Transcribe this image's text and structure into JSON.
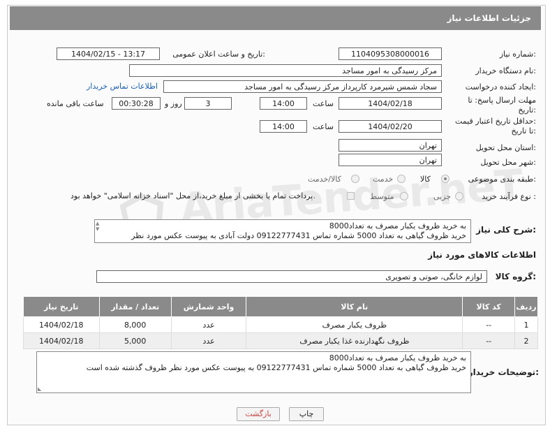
{
  "header": {
    "title": "جزئیات اطلاعات نیاز"
  },
  "fields": {
    "need_number_label": "شماره نیاز:",
    "need_number": "1104095308000016",
    "announce_label": "تاریخ و ساعت اعلان عمومی:",
    "announce_value": "1404/02/15 - 13:17",
    "buyer_org_label": "نام دستگاه خریدار:",
    "buyer_org": "مرکز رسیدگی به امور مساجد",
    "requester_label": "ایجاد کننده درخواست:",
    "requester": "سجاد شمس شیرمرد کارپرداز مرکز رسیدگی به امور مساجد",
    "buyer_contact_link": "اطلاعات تماس خریدار",
    "deadline_label_1": "مهلت ارسال پاسخ: تا",
    "deadline_label_2": "تاریخ:",
    "deadline_date": "1404/02/18",
    "time_label": "ساعت",
    "deadline_time": "14:00",
    "days_value": "3",
    "days_label": "روز و",
    "remaining_value": "00:30:28",
    "remaining_label": "ساعت باقی مانده",
    "validity_label_1": "حداقل تاریخ اعتبار قیمت:",
    "validity_label_2": "تا تاریخ:",
    "validity_date": "1404/02/20",
    "validity_time": "14:00",
    "province_label": "استان محل تحویل:",
    "province": "تهران",
    "city_label": "شهر محل تحویل:",
    "city": "تهران",
    "category_label": "طبقه بندی موضوعی:",
    "category_options": [
      "کالا",
      "خدمت",
      "کالا/خدمت"
    ],
    "process_label": "نوع فرآیند خرید :",
    "process_options": [
      "جزیی",
      "متوسط"
    ],
    "payment_note": "پرداخت تمام یا بخشی از مبلغ خرید،از محل \"اسناد خزانه اسلامی\" خواهد بود."
  },
  "summary": {
    "label": "شرح کلی نیاز:",
    "line1": "به خرید ظروف یکبار مصرف به تعداد8000",
    "line2": "خرید ظروف گیاهی به تعداد 5000   شماره تماس 09122777431  دولت آبادی به پیوست عکس مورد نظر"
  },
  "goods": {
    "section_title": "اطلاعات کالاهای مورد نیاز",
    "group_label": "گروه کالا:",
    "group_value": "لوازم خانگی، صوتی و تصویری",
    "columns": [
      "ردیف",
      "کد کالا",
      "نام کالا",
      "واحد شمارش",
      "تعداد / مقدار",
      "تاریخ نیاز"
    ],
    "rows": [
      {
        "idx": "1",
        "code": "--",
        "name": "ظروف یکبار مصرف",
        "unit": "عدد",
        "qty": "8,000",
        "date": "1404/02/18"
      },
      {
        "idx": "2",
        "code": "--",
        "name": "ظروف نگهدارنده غذا یکبار مصرف",
        "unit": "عدد",
        "qty": "5,000",
        "date": "1404/02/18"
      }
    ]
  },
  "buyer_notes": {
    "label": "توضیحات خریدار:",
    "line1": "به خرید ظروف یکبار مصرف به تعداد8000",
    "line2": "خرید ظروف گیاهی به تعداد 5000   شماره تماس 09122777431 به پیوست عکس مورد نظر ظروف گذشته شده است"
  },
  "buttons": {
    "print": "چاپ",
    "back": "بازگشت"
  },
  "watermark": "AriaTender.neT"
}
